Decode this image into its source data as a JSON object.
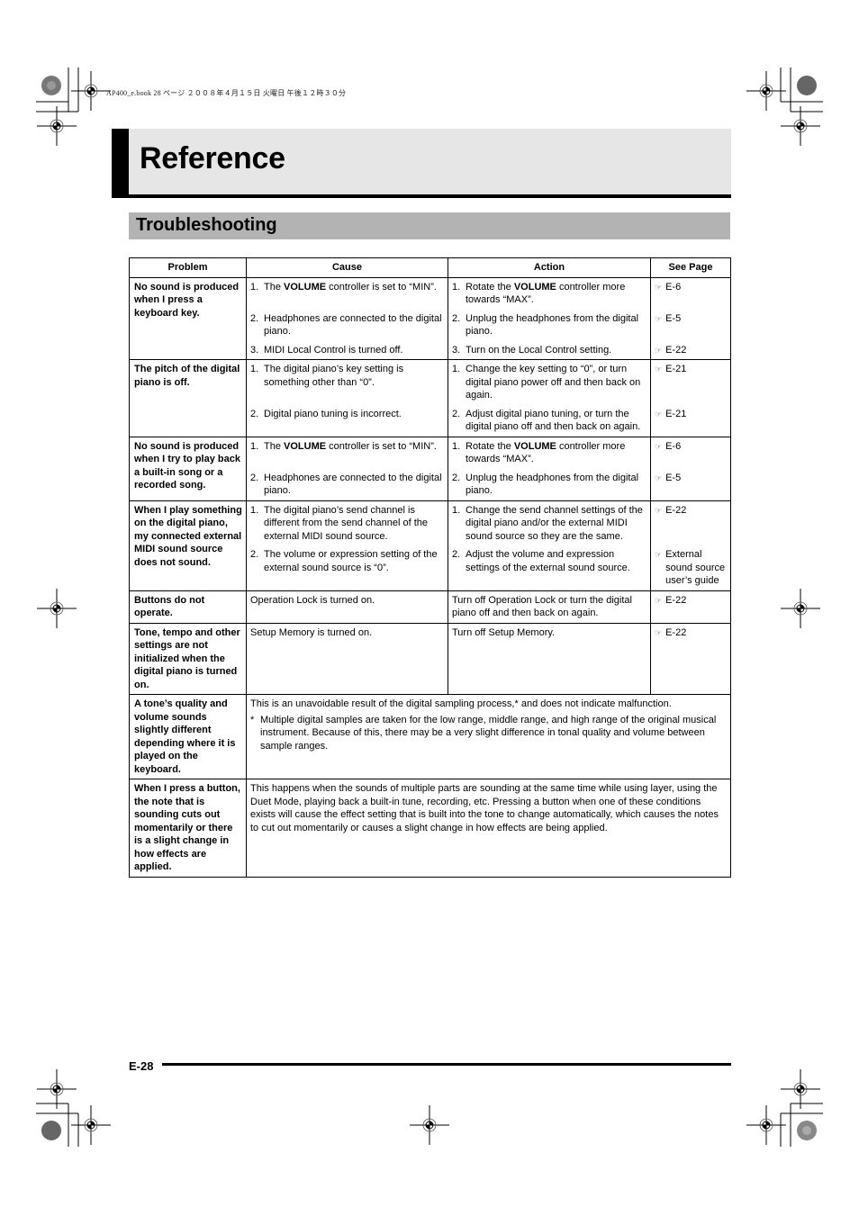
{
  "print_header": "AP400_e.book  28 ページ  ２００８年４月１５日  火曜日  午後１２時３０分",
  "chapter_title": "Reference",
  "section_title": "Troubleshooting",
  "table": {
    "headers": [
      "Problem",
      "Cause",
      "Action",
      "See Page"
    ],
    "rows": [
      {
        "problem": "No sound is produced when I press a keyboard key.",
        "items": [
          {
            "num": "1.",
            "cause_pre": "The ",
            "cause_bold": "VOLUME",
            "cause_post": " controller is set to “MIN”.",
            "action_pre": "Rotate the ",
            "action_bold": "VOLUME",
            "action_post": " controller more towards “MAX”.",
            "see": "E-6"
          },
          {
            "num": "2.",
            "cause_pre": "Headphones are connected to the digital piano.",
            "cause_bold": "",
            "cause_post": "",
            "action_pre": "Unplug the headphones from the digital piano.",
            "action_bold": "",
            "action_post": "",
            "see": "E-5"
          },
          {
            "num": "3.",
            "cause_pre": "MIDI Local Control is turned off.",
            "cause_bold": "",
            "cause_post": "",
            "action_pre": "Turn on the Local Control setting.",
            "action_bold": "",
            "action_post": "",
            "see": "E-22"
          }
        ]
      },
      {
        "problem": "The pitch of the digital piano is off.",
        "items": [
          {
            "num": "1.",
            "cause_pre": "The digital piano’s key setting is something other than “0”.",
            "cause_bold": "",
            "cause_post": "",
            "action_pre": "Change the key setting to “0”, or turn digital piano power off and then back on again.",
            "action_bold": "",
            "action_post": "",
            "see": "E-21"
          },
          {
            "num": "2.",
            "cause_pre": "Digital piano tuning is incorrect.",
            "cause_bold": "",
            "cause_post": "",
            "action_pre": "Adjust digital piano tuning, or turn the digital piano off and then back on again.",
            "action_bold": "",
            "action_post": "",
            "see": "E-21"
          }
        ]
      },
      {
        "problem": "No sound is produced when I try to play back a built-in song or a recorded song.",
        "items": [
          {
            "num": "1.",
            "cause_pre": "The ",
            "cause_bold": "VOLUME",
            "cause_post": " controller is set to “MIN”.",
            "action_pre": "Rotate the ",
            "action_bold": "VOLUME",
            "action_post": " controller more towards “MAX”.",
            "see": "E-6"
          },
          {
            "num": "2.",
            "cause_pre": "Headphones are connected to the digital piano.",
            "cause_bold": "",
            "cause_post": "",
            "action_pre": "Unplug the headphones from the digital piano.",
            "action_bold": "",
            "action_post": "",
            "see": "E-5"
          }
        ]
      },
      {
        "problem": "When I play something on the digital piano, my connected external MIDI sound source does not sound.",
        "items": [
          {
            "num": "1.",
            "cause_pre": "The digital piano’s send channel is different from the send channel of the external MIDI sound source.",
            "cause_bold": "",
            "cause_post": "",
            "action_pre": "Change the send channel settings of the digital piano and/or the external MIDI sound source so they are the same.",
            "action_bold": "",
            "action_post": "",
            "see": "E-22"
          },
          {
            "num": "2.",
            "cause_pre": "The volume or expression setting of the external sound source is “0”.",
            "cause_bold": "",
            "cause_post": "",
            "action_pre": "Adjust the volume and expression settings of the external sound source.",
            "action_bold": "",
            "action_post": "",
            "see": "External sound source user’s guide"
          }
        ]
      },
      {
        "problem": "Buttons do not operate.",
        "cause": "Operation Lock is turned on.",
        "action": "Turn off Operation Lock or turn the digital piano off and then back on again.",
        "see": "E-22"
      },
      {
        "problem": "Tone, tempo and other settings are not initialized when the digital piano is turned on.",
        "cause": "Setup Memory is turned on.",
        "action": "Turn off Setup Memory.",
        "see": "E-22"
      },
      {
        "problem": "A tone’s quality and volume sounds slightly different depending where it is played on the keyboard.",
        "explanation": "This is an unavoidable result of the digital sampling process,* and does not indicate malfunction.",
        "note_mark": "*",
        "note": "Multiple digital samples are taken for the low range, middle range, and high range of the original musical instrument. Because of this, there may be a very slight difference in tonal quality and volume between sample ranges."
      },
      {
        "problem": "When I press a button, the note that is sounding cuts out momentarily or there is a slight change in how effects are applied.",
        "explanation": "This happens when the sounds of multiple parts are sounding at the same time while using layer, using the Duet Mode, playing back a built-in tune, recording, etc. Pressing a button when one of these conditions exists will cause the effect setting that is built into the tone to change automatically, which causes the notes to cut out momentarily or causes a slight change in how effects are being applied."
      }
    ]
  },
  "see_page_icon": "pointing-hand-icon",
  "see_page_glyph": "☞",
  "footer": {
    "page_number": "E-28"
  }
}
